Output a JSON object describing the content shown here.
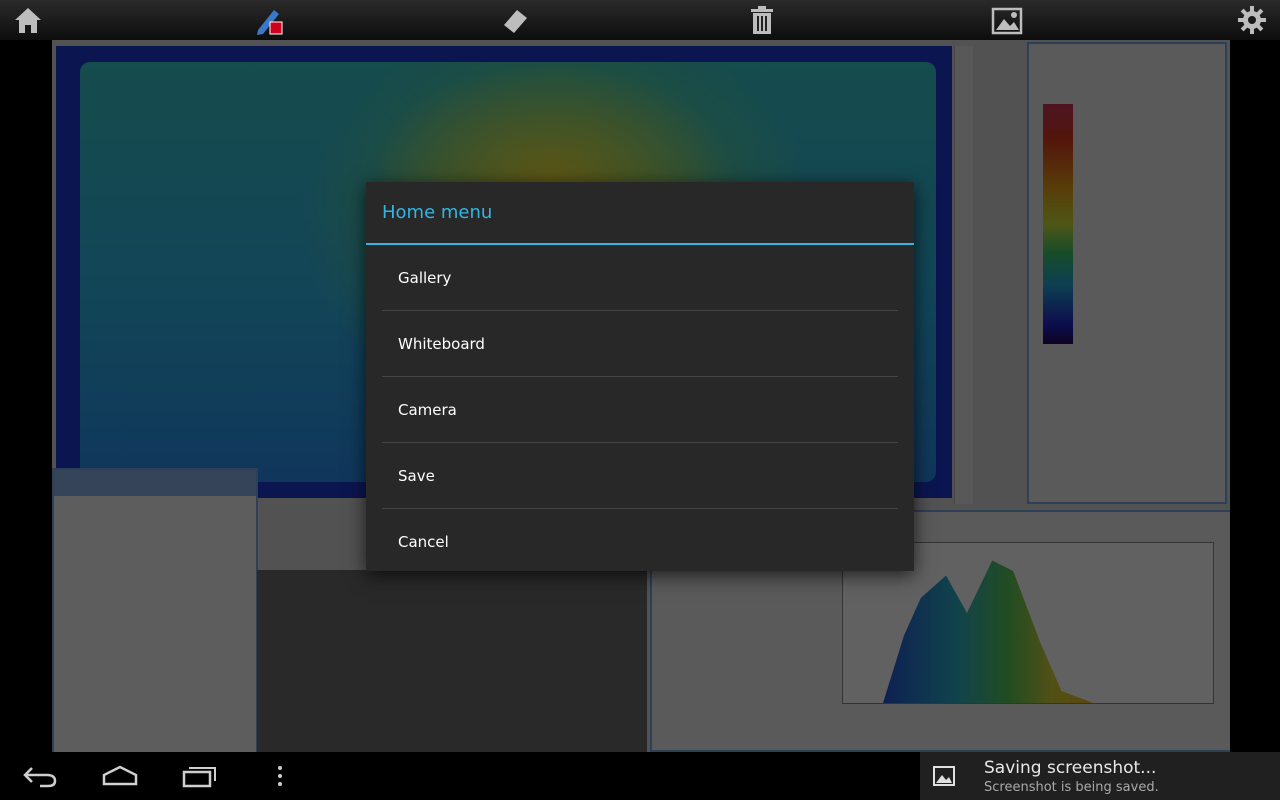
{
  "dialog": {
    "title": "Home menu",
    "items": [
      {
        "label": "Gallery"
      },
      {
        "label": "Whiteboard"
      },
      {
        "label": "Camera"
      },
      {
        "label": "Save"
      },
      {
        "label": "Cancel"
      }
    ]
  },
  "toolbar": {
    "icons": [
      "home-icon",
      "pen-color-icon",
      "eraser-icon",
      "trash-icon",
      "image-icon",
      "settings-icon"
    ]
  },
  "notification": {
    "title": "Saving screenshot...",
    "subtitle": "Screenshot is being saved."
  },
  "navbar": {
    "icons": [
      "back-icon",
      "home-nav-icon",
      "recent-apps-icon",
      "overflow-menu-icon"
    ]
  },
  "colors": {
    "accent": "#33b5e5",
    "dialog_bg": "#282828",
    "pen_color": "#d0021b"
  }
}
